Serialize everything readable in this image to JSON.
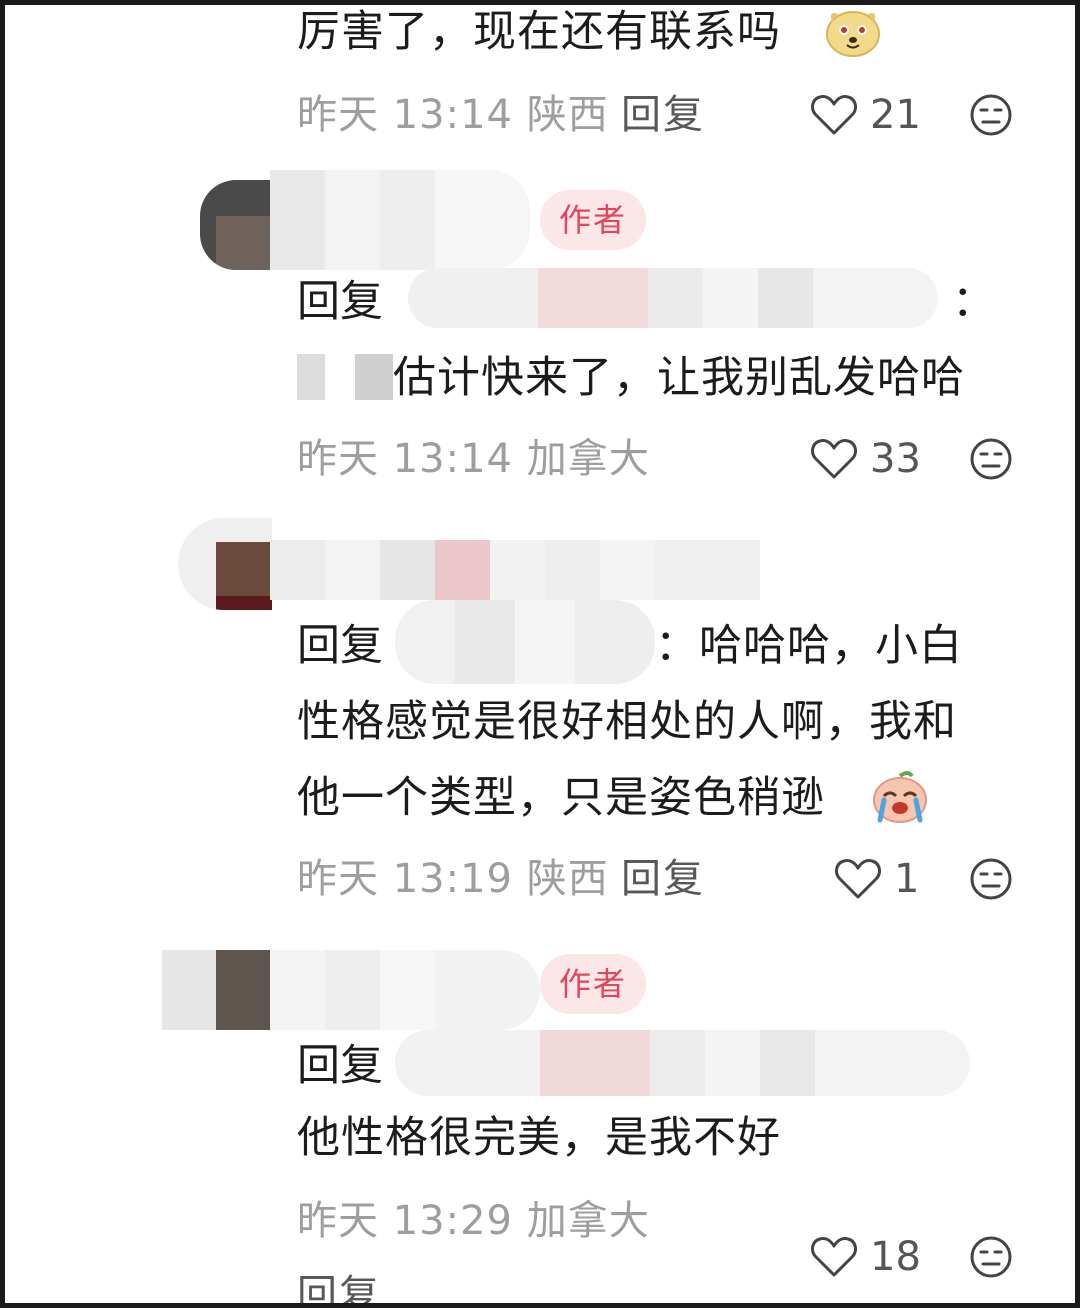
{
  "comments": [
    {
      "text_lines": [
        "厉害了，现在还有联系吗"
      ],
      "emoji": "dog-face-emoji",
      "time": "昨天 13:14",
      "location": "陕西",
      "reply_label": "回复",
      "likes": "21"
    },
    {
      "badge": "作者",
      "reply_prefix": "回复",
      "reply_colon": "：",
      "text_lines": [
        "估计快来了，让我别乱发哈哈"
      ],
      "time": "昨天 13:14",
      "location": "加拿大",
      "likes": "33"
    },
    {
      "reply_prefix": "回复",
      "reply_tail": "：哈哈哈，小白",
      "text_lines": [
        "性格感觉是很好相处的人啊，我和",
        "他一个类型，只是姿色稍逊"
      ],
      "emoji": "crying-peach-emoji",
      "time": "昨天 13:19",
      "location": "陕西",
      "reply_label": "回复",
      "likes": "1"
    },
    {
      "badge": "作者",
      "reply_prefix": "回复",
      "text_lines": [
        "他性格很完美，是我不好"
      ],
      "time": "昨天 13:29",
      "location": "加拿大",
      "reply_label": "回复",
      "likes": "18"
    }
  ],
  "icons": {
    "like": "heart-outline-icon",
    "dislike": "neutral-face-icon"
  },
  "colors": {
    "badge_bg": "#fbe6e8",
    "badge_text": "#e0465d",
    "meta_text": "#9e9e9e"
  }
}
